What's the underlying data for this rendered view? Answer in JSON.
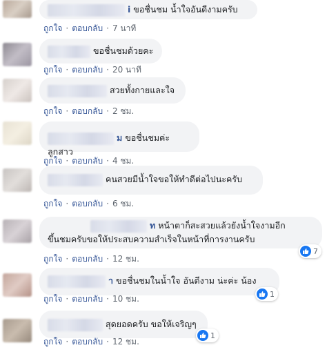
{
  "actions": {
    "like": "ถูกใจ",
    "reply": "ตอบกลับ",
    "separator": "·"
  },
  "colors": {
    "link": "#385898",
    "bubble": "#f2f3f5",
    "like_badge": "#1877f2"
  },
  "comments": [
    {
      "name_suffix": "i",
      "text": "ขอชื่นชม น้ำใจอันดีงามครับ",
      "time": "7 นาที"
    },
    {
      "name_suffix": "",
      "text": "ขอชื่นชมด้วยคะ",
      "time": "20 นาที"
    },
    {
      "name_suffix": "",
      "text": "สวยทั้งกายและใจ",
      "time": "2 ชม."
    },
    {
      "name_suffix": "ม",
      "text": "ขอชื่นชมค่ะลูกสาว",
      "time": "4 ชม."
    },
    {
      "name_suffix": "",
      "text": "คนสวยมีน้ำใจขอให้ทำดีต่อไปนะครับ",
      "time": "6 ชม."
    },
    {
      "name_suffix": "ท",
      "text_line1": "หน้าตาก็สะสวยแล้วยังน้ำใจงามอีก",
      "text_line2": "ขึ้นชมครับขอให้ประสบความสำเร็จในหน้าที่การงานครับ",
      "time": "12 ชม.",
      "reactions": "7"
    },
    {
      "name_suffix": "า",
      "text": "ขอชื่นชมในน้ำใจ อันดีงาม น่ะค่ะ น้อง",
      "time": "10 ชม.",
      "reactions": "1"
    },
    {
      "name_suffix": "",
      "text": "สุดยอดครับ ขอให้เจริญๆ",
      "time": "12 ชม.",
      "reactions": "1"
    }
  ]
}
